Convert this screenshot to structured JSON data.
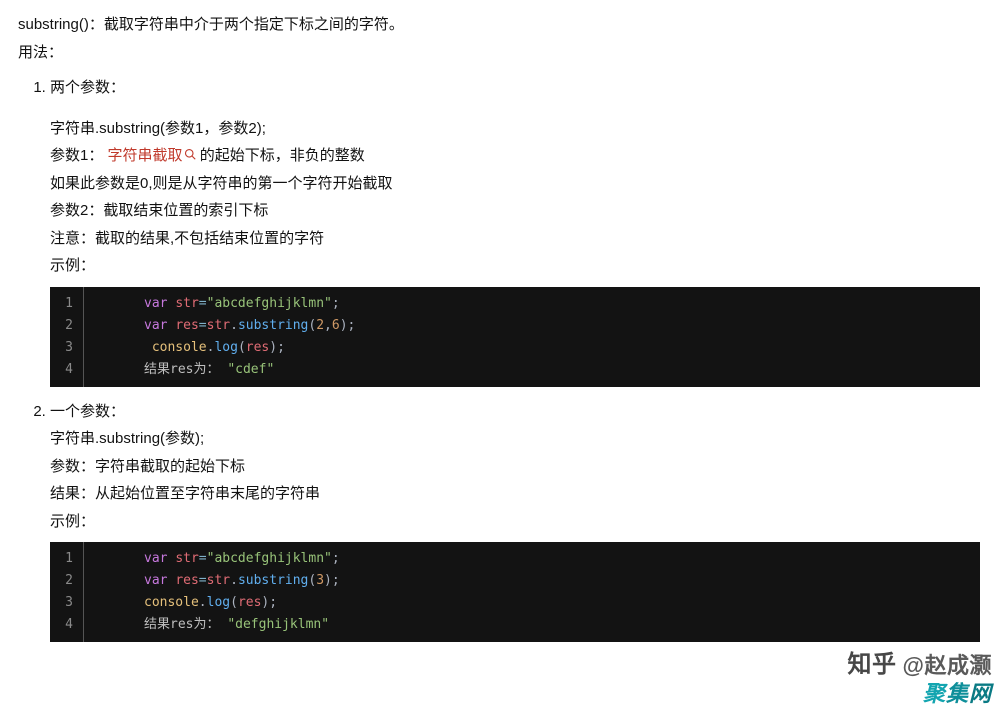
{
  "intro": {
    "line1": "substring()：截取字符串中介于两个指定下标之间的字符。",
    "line2": "用法："
  },
  "items": [
    {
      "title": "两个参数：",
      "l1": "字符串.substring(参数1，参数2);",
      "l2a": "参数1：",
      "l2link": "字符串截取",
      "l2b": " 的起始下标，非负的整数",
      "l3": "如果此参数是0,则是从字符串的第一个字符开始截取",
      "l4": "参数2：截取结束位置的索引下标",
      "l5": "注意：截取的结果,不包括结束位置的字符",
      "l6": "示例：",
      "code": {
        "nums": [
          "1",
          "2",
          "3",
          "4"
        ],
        "var": "var",
        "str_id": "str",
        "eq": "=",
        "strlit": "\"abcdefghijklmn\"",
        "semi": ";",
        "res_id": "res",
        "eq2": "=",
        "str_ref": "str",
        "dot": ".",
        "fn": "substring",
        "lp": "(",
        "n1": "2",
        "comma": ",",
        "n2": "6",
        "rp": ")",
        "semi2": ";",
        "console": "console",
        "dot2": ".",
        "log": "log",
        "lp2": "(",
        "res_ref": "res",
        "rp2": ")",
        "semi3": ";",
        "result_label": "结果res为：",
        "result_val": "\"cdef\""
      }
    },
    {
      "title": "一个参数：",
      "l1": "字符串.substring(参数);",
      "l2": "参数：字符串截取的起始下标",
      "l3": "结果：从起始位置至字符串末尾的字符串",
      "l4": "示例：",
      "code": {
        "nums": [
          "1",
          "2",
          "3",
          "4"
        ],
        "var": "var",
        "str_id": "str",
        "eq": "=",
        "strlit": "\"abcdefghijklmn\"",
        "semi": ";",
        "res_id": "res",
        "eq2": "=",
        "str_ref": "str",
        "dot": ".",
        "fn": "substring",
        "lp": "(",
        "n1": "3",
        "rp": ")",
        "semi2": ";",
        "console": "console",
        "dot2": ".",
        "log": "log",
        "lp2": "(",
        "res_ref": "res",
        "rp2": ")",
        "semi3": ";",
        "result_label": "结果res为：",
        "result_val": "\"defghijklmn\""
      }
    }
  ],
  "watermark": {
    "brand": "知乎",
    "author": "@赵成灏"
  },
  "sitemark": {
    "t1": "聚",
    "t2": "集",
    "t3": "网"
  }
}
